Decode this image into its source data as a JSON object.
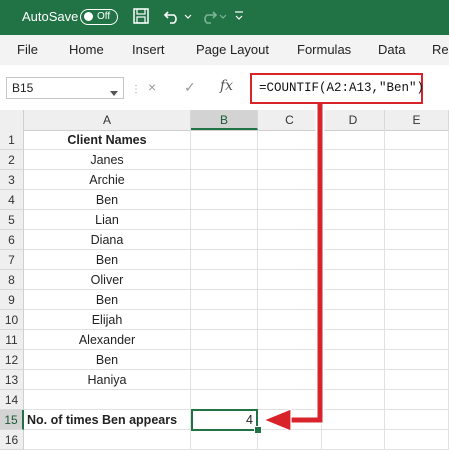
{
  "titlebar": {
    "autosave_label": "AutoSave",
    "autosave_state": "Off",
    "icons": [
      "save-icon",
      "undo-icon",
      "redo-icon",
      "customize-quick-access-icon"
    ],
    "color": "#217346"
  },
  "menu": {
    "items": [
      "File",
      "Home",
      "Insert",
      "Page Layout",
      "Formulas",
      "Data",
      "Re"
    ]
  },
  "formula_bar": {
    "name_box": "B15",
    "cancel_icon": "×",
    "enter_icon": "✓",
    "fx_label": "fx",
    "formula": "=COUNTIF(A2:A13,\"Ben\")"
  },
  "grid": {
    "columns": [
      "A",
      "B",
      "C",
      "D",
      "E"
    ],
    "selected_column": "B",
    "selected_row": "15",
    "rows": [
      {
        "num": "1",
        "a": "Client Names",
        "b": ""
      },
      {
        "num": "2",
        "a": "Janes",
        "b": ""
      },
      {
        "num": "3",
        "a": "Archie",
        "b": ""
      },
      {
        "num": "4",
        "a": "Ben",
        "b": ""
      },
      {
        "num": "5",
        "a": "Lian",
        "b": ""
      },
      {
        "num": "6",
        "a": "Diana",
        "b": ""
      },
      {
        "num": "7",
        "a": "Ben",
        "b": ""
      },
      {
        "num": "8",
        "a": "Oliver",
        "b": ""
      },
      {
        "num": "9",
        "a": "Ben",
        "b": ""
      },
      {
        "num": "10",
        "a": "Elijah",
        "b": ""
      },
      {
        "num": "11",
        "a": "Alexander",
        "b": ""
      },
      {
        "num": "12",
        "a": "Ben",
        "b": ""
      },
      {
        "num": "13",
        "a": "Haniya",
        "b": ""
      },
      {
        "num": "14",
        "a": "",
        "b": ""
      },
      {
        "num": "15",
        "a": "No. of times Ben appears",
        "b": "4"
      },
      {
        "num": "16",
        "a": "",
        "b": ""
      }
    ]
  },
  "annotation": {
    "color": "#d9232b"
  }
}
